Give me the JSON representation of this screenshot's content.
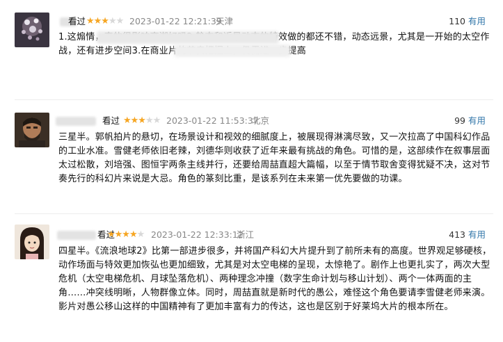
{
  "reviews": [
    {
      "watched": "看过",
      "rating": 3,
      "time": "2023-01-22 12:21:39",
      "location": "天津",
      "votes": "110",
      "useful": "有用",
      "text": "1.这煽情，真的很影响高潮好吗2.静态和近景动态的特效做的都还不错，动态远景，尤其是一开始的太空作战，还有进步空间3.在商业片的节奏把握上，仍需进一步提高"
    },
    {
      "watched": "看过",
      "rating": 3,
      "time": "2023-01-22 11:53:37",
      "location": "北京",
      "votes": "99",
      "useful": "有用",
      "text": "三星半。郭帆拍片的悬切，在场景设计和视效的细腻度上，被展现得淋漓尽致，又一次拉高了中国科幻作品的工业水准。雪健老师依旧老辣，刘德华则收获了近年来最有挑战的角色。可惜的是，这部续作在叙事层面太过松散，刘培强、图恒宇两条主线并行，还要给周喆直超大篇幅，以至于情节取舍变得犹疑不决，这对节奏先行的科幻片来说是大忌。角色的篆刻比重，是该系列在未来第一优先要做的功课。"
    },
    {
      "watched": "看过",
      "rating": 4,
      "time": "2023-01-22 12:33:12",
      "location": "浙江",
      "votes": "413",
      "useful": "有用",
      "text": "四星半。《流浪地球2》比第一部进步很多，并将国产科幻大片提升到了前所未有的高度。世界观足够硬核，动作场面与特效更加恢弘也更加细致，尤其是对太空电梯的呈现，太惊艳了。剧作上也更扎实了，两次大型危机（太空电梯危机、月球坠落危机）、两种理念冲撞（数字生命计划与移山计划）、两个一体两面的主角……冲突线明晰，人物群像立体。同时，周喆直就是新时代的愚公，难怪这个角色要请李雪健老师来演。影片对愚公移山这样的中国精神有了更加丰富有力的传达，这也是区别于好莱坞大片的根本所在。"
    }
  ],
  "colors": {
    "star": "#f6a623",
    "link": "#3377aa",
    "meta": "#888888"
  }
}
